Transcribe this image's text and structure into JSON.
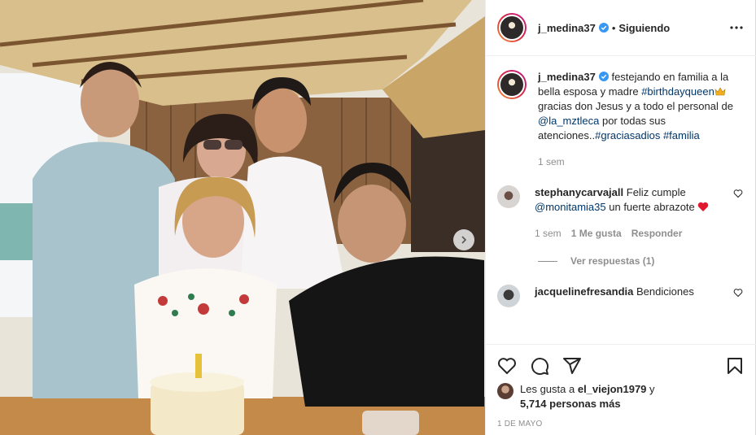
{
  "post": {
    "username": "j_medina37",
    "follow_separator": "•",
    "follow_label": "Siguiendo"
  },
  "caption": {
    "username": "j_medina37",
    "text_1": "festejando en familia a la bella esposa y madre",
    "hashtag_1": "#birthdayqueen",
    "text_2": "gracias don Jesus y a todo el personal de",
    "mention_1": "@la_mztleca",
    "text_3": "por todas sus atenciones..",
    "hashtag_2": "#graciasadios",
    "hashtag_3": "#familia",
    "time": "1 sem"
  },
  "comments": [
    {
      "username": "stephanycarvajall",
      "text_1": "Feliz cumple",
      "mention": "@monitamia35",
      "text_2": "un fuerte abrazote",
      "time": "1 sem",
      "likes": "1 Me gusta",
      "reply_label": "Responder",
      "view_replies": "Ver respuestas (1)"
    },
    {
      "username": "jacquelinefresandia",
      "text_1": "Bendiciones"
    }
  ],
  "likes": {
    "prefix": "Les gusta a",
    "user": "el_viejon1979",
    "conj": "y",
    "count": "5,714 personas más"
  },
  "date": "1 DE MAYO",
  "icons": [
    "verified-icon",
    "more-options-icon",
    "heart-icon",
    "comment-icon",
    "share-icon",
    "save-icon",
    "chevron-right-icon",
    "crown-emoji",
    "red-heart-emoji"
  ],
  "colors": {
    "link": "#00376b",
    "verified": "#3897f0",
    "muted": "#8e8e8e",
    "text": "#262626"
  }
}
